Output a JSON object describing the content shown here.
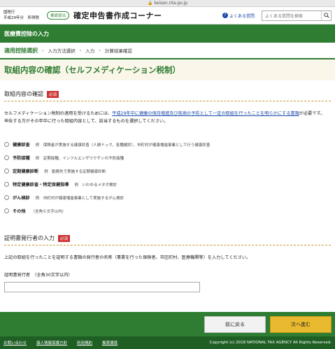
{
  "browser": {
    "url": "keisan.nta.go.jp"
  },
  "header": {
    "agency": "国税庁",
    "tax_year": "平成29年分　所得税",
    "badge": "書面提出",
    "site_title": "確定申告書作成コーナー",
    "faq_label": "よくある質問",
    "search_placeholder": "よくある質問を検索"
  },
  "section_bar": {
    "title": "医療費控除の入力"
  },
  "steps": [
    "適用控除選択",
    "入力方法選択",
    "入力",
    "計算結果確認"
  ],
  "page_title": "取組内容の確認（セルフメディケーション税制）",
  "section1": {
    "heading": "取組内容の確認",
    "required": "必須",
    "desc_a": "セルフメディケーション税制の適用を受けるためには、",
    "desc_link": "平成29年中に健康の保持増進及び疾病の予防として一定の取組を行ったことを明らかにする書類",
    "desc_b": "が必要です。",
    "desc_c": "申告する方がその年中に行った取組内容として、該当するものを選択してください。",
    "options": [
      {
        "label": "健康診査",
        "example": "例　保険者が実施する健康診査（人間ドック、各種健診）、市町村が健康増進事業として行う健康診査"
      },
      {
        "label": "予防接種",
        "example": "例　定期接種、インフルエンザワクチンの予防接種"
      },
      {
        "label": "定期健康診断",
        "example": "例　勤務先で実施する定期健康診断"
      },
      {
        "label": "特定健康診査・特定保健指導",
        "example": "例　いわゆるメタボ検診"
      },
      {
        "label": "がん検診",
        "example": "例　市町村が健康増進事業として実施するがん検診"
      },
      {
        "label": "その他",
        "example": "（全角６文字以内）"
      }
    ]
  },
  "section2": {
    "heading": "証明書発行者の入力",
    "required": "必須",
    "desc": "上記の取組を行ったことを証明する書類の発行者の名称（事業を行った保険者、市区町村、医療機関等）を入力してください。",
    "field_label": "証明書発行者　（全角30文字以内）",
    "field_value": ""
  },
  "actions": {
    "back": "前に戻る",
    "next": "次へ進む"
  },
  "footer": {
    "links": [
      "お問い合わせ",
      "個人情報保護方針",
      "利用規約",
      "推奨環境"
    ],
    "copyright": "Copyright (c) 2018 NATIONAL TAX AGENCY All Rights Reserved."
  }
}
